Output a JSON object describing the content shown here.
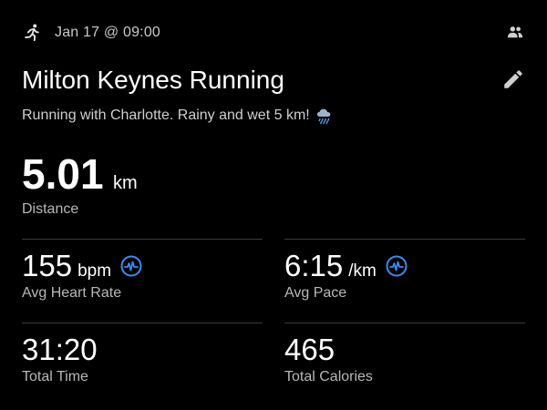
{
  "header": {
    "date": "Jan 17 @ 09:00",
    "activity_icon": "running-icon",
    "people_icon": "group-icon"
  },
  "activity": {
    "title": "Milton Keynes Running",
    "description": "Running with Charlotte. Rainy and wet 5 km!",
    "weather_icon": "rain-cloud-icon",
    "edit_icon": "pencil-icon"
  },
  "distance": {
    "value": "5.01",
    "unit": "km",
    "label": "Distance"
  },
  "stats": {
    "heart_rate": {
      "value": "155",
      "unit": "bpm",
      "label": "Avg Heart Rate"
    },
    "pace": {
      "value": "6:15",
      "unit": "/km",
      "label": "Avg Pace"
    },
    "time": {
      "value": "31:20",
      "label": "Total Time"
    },
    "calories": {
      "value": "465",
      "label": "Total Calories"
    }
  },
  "colors": {
    "background": "#000000",
    "accent": "#3b8cf0",
    "divider": "#3d3d3d"
  }
}
